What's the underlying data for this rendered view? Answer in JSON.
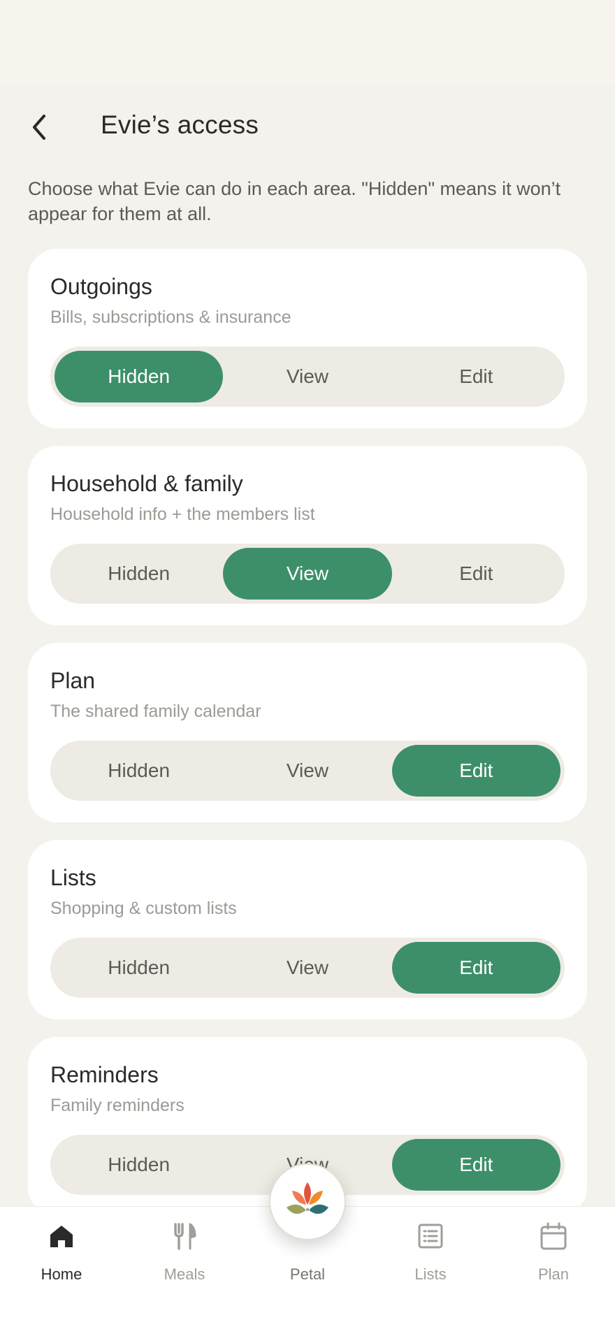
{
  "header": {
    "title": "Evie’s access"
  },
  "intro": "Choose what Evie can do in each area. \"Hidden\" means it won’t appear for them at all.",
  "segment_labels": [
    "Hidden",
    "View",
    "Edit"
  ],
  "cards": [
    {
      "title": "Outgoings",
      "subtitle": "Bills, subscriptions & insurance",
      "selected": "Hidden"
    },
    {
      "title": "Household & family",
      "subtitle": "Household info + the members list",
      "selected": "View"
    },
    {
      "title": "Plan",
      "subtitle": "The shared family calendar",
      "selected": "Edit"
    },
    {
      "title": "Lists",
      "subtitle": "Shopping & custom lists",
      "selected": "Edit"
    },
    {
      "title": "Reminders",
      "subtitle": "Family reminders",
      "selected": "Edit"
    }
  ],
  "nav": {
    "items": [
      {
        "label": "Home",
        "icon": "home-icon",
        "active": true
      },
      {
        "label": "Meals",
        "icon": "fork-knife-icon",
        "active": false
      },
      {
        "label": "Petal",
        "icon": "petal-logo-icon",
        "active": false
      },
      {
        "label": "Lists",
        "icon": "list-icon",
        "active": false
      },
      {
        "label": "Plan",
        "icon": "calendar-icon",
        "active": false
      }
    ]
  },
  "colors": {
    "accent": "#3d8f6a",
    "background": "#f4f2ed",
    "card": "#ffffff",
    "segment_track": "#eeebe4"
  }
}
